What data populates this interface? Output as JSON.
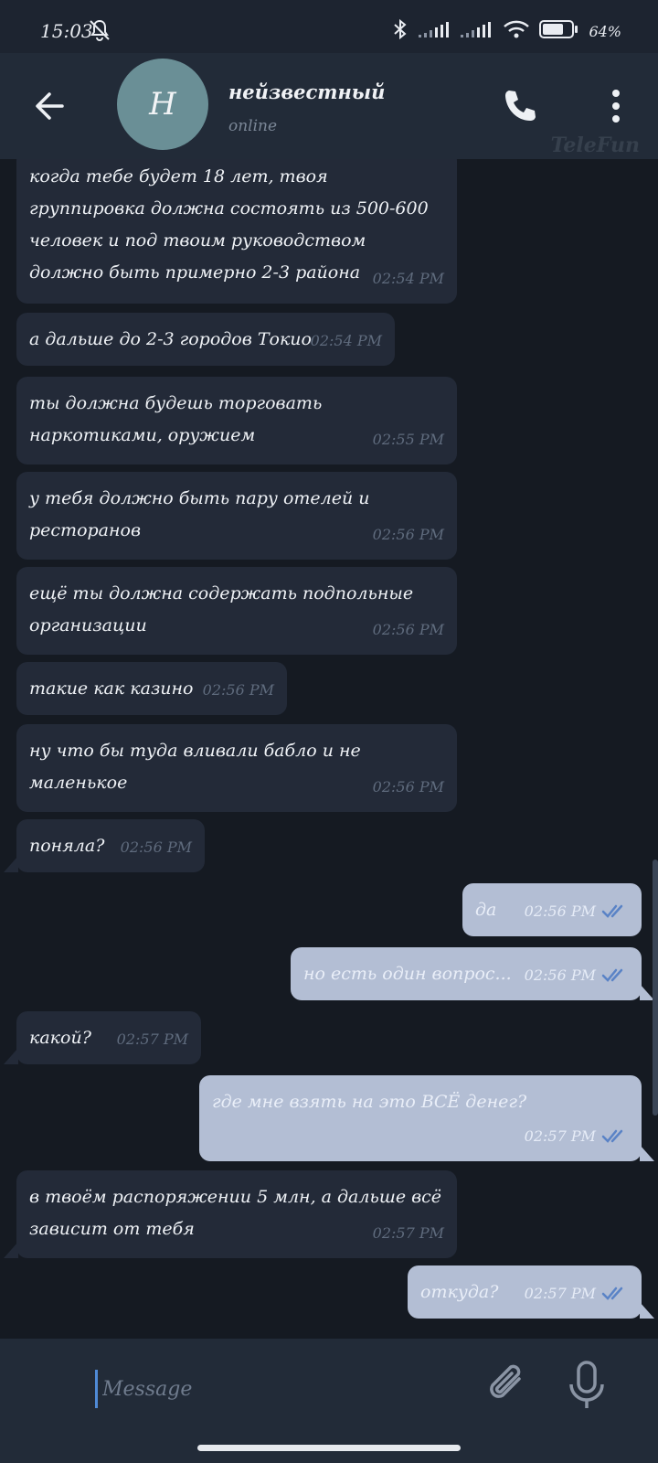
{
  "status_bar": {
    "time": "15:03",
    "battery": "64%",
    "icons": [
      "bell-off-icon",
      "bluetooth-icon",
      "signal-icon",
      "signal-icon",
      "wifi-icon",
      "battery-icon"
    ]
  },
  "header": {
    "avatar_letter": "H",
    "contact_name": "нейзвестный",
    "contact_status": "online",
    "watermark": "TeleFun",
    "icons": [
      "arrow-left-icon",
      "phone-icon",
      "more-vertical-icon"
    ]
  },
  "messages": [
    {
      "dir": "in",
      "text": "когда тебе будет 18 лет, твоя группировка должна состоять из 500-600 человек и под твоим руководством должно быть примерно 2-3 района",
      "time": "02:54 PM"
    },
    {
      "dir": "in",
      "text": "а дальше до 2-3 городов Токио",
      "time": "02:54 PM"
    },
    {
      "dir": "in",
      "text": "ты должна будешь торговать наркотиками, оружием",
      "time": "02:55 PM"
    },
    {
      "dir": "in",
      "text": "у тебя должно быть пару отелей и ресторанов",
      "time": "02:56 PM"
    },
    {
      "dir": "in",
      "text": "ещё ты должна содержать подпольные организации",
      "time": "02:56 PM"
    },
    {
      "dir": "in",
      "text": "такие как казино",
      "time": "02:56 PM"
    },
    {
      "dir": "in",
      "text": "ну что бы туда вливали бабло и не маленькое",
      "time": "02:56 PM"
    },
    {
      "dir": "in",
      "text": "поняла?",
      "time": "02:56 PM"
    },
    {
      "dir": "out",
      "text": "да",
      "time": "02:56 PM"
    },
    {
      "dir": "out",
      "text": "но есть один вопрос...",
      "time": "02:56 PM"
    },
    {
      "dir": "in",
      "text": "какой?",
      "time": "02:57 PM"
    },
    {
      "dir": "out",
      "text": "где мне взять на это ВСЁ денег?",
      "time": "02:57 PM"
    },
    {
      "dir": "in",
      "text": "в твоём распоряжении 5 млн, а дальше всё зависит от тебя",
      "time": "02:57 PM"
    },
    {
      "dir": "out",
      "text": "откуда?",
      "time": "02:57 PM"
    }
  ],
  "input": {
    "placeholder": "Message",
    "icons": [
      "paperclip-icon",
      "microphone-icon"
    ]
  }
}
